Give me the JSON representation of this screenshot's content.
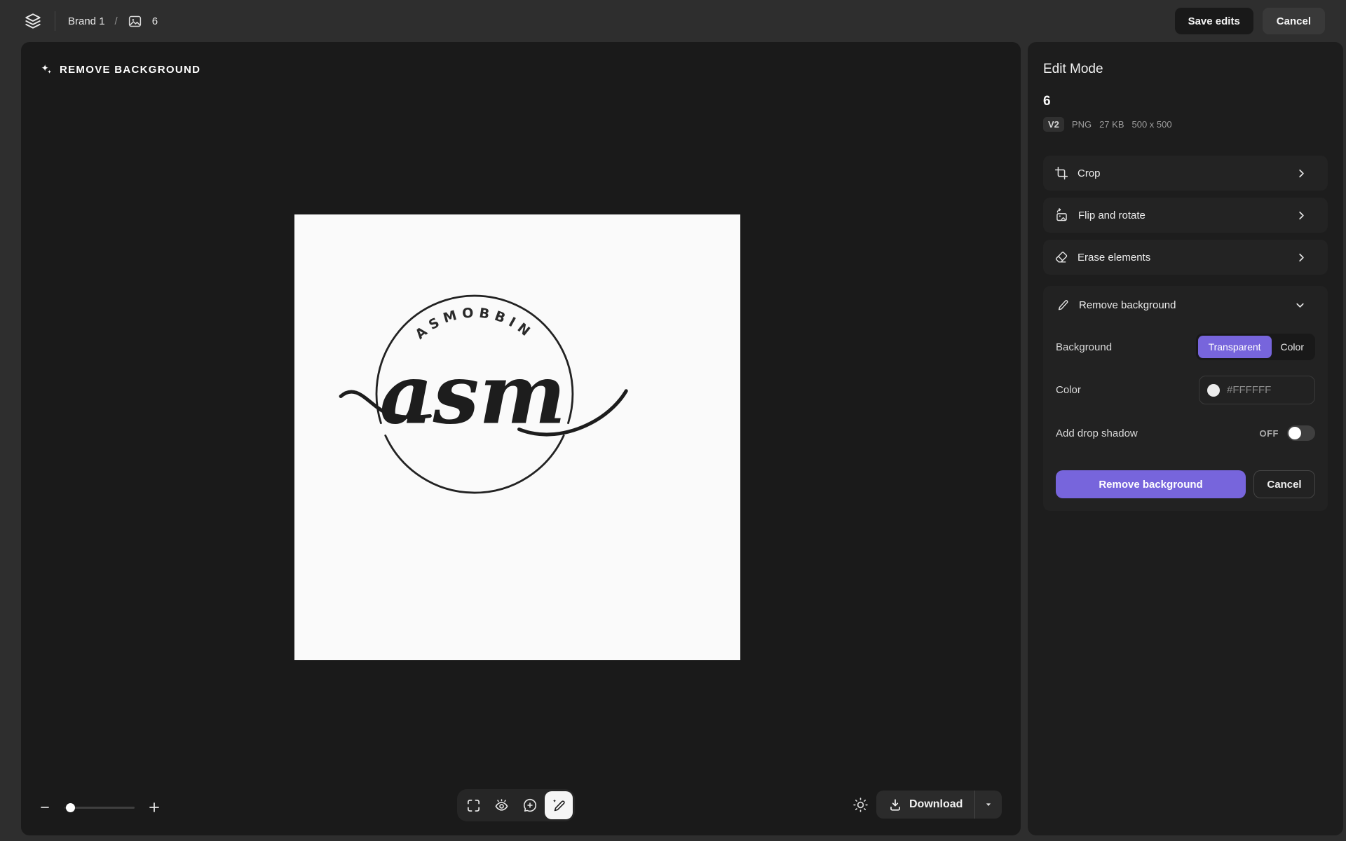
{
  "topbar": {
    "brand": "Brand 1",
    "separator": "/",
    "asset_count": "6",
    "save_label": "Save edits",
    "cancel_label": "Cancel"
  },
  "canvas": {
    "mode_label": "REMOVE BACKGROUND",
    "download_label": "Download",
    "logo": {
      "arc_text": "ASMOBBIN",
      "script_text": "asm"
    }
  },
  "sidebar": {
    "title": "Edit Mode",
    "asset_name": "6",
    "meta": {
      "version": "V2",
      "format": "PNG",
      "file_size": "27 KB",
      "dimensions": "500 x 500"
    },
    "tools": [
      {
        "label": "Crop"
      },
      {
        "label": "Flip and rotate"
      },
      {
        "label": "Erase elements"
      }
    ],
    "remove_bg": {
      "label": "Remove background",
      "background_label": "Background",
      "option_transparent": "Transparent",
      "option_color": "Color",
      "selected_option": "Transparent",
      "color_label": "Color",
      "color_placeholder": "#FFFFFF",
      "shadow_label": "Add drop shadow",
      "shadow_state": "OFF",
      "apply_label": "Remove background",
      "cancel_label": "Cancel"
    }
  },
  "colors": {
    "accent": "#7765dc",
    "topbar_bg": "#2e2e2e",
    "canvas_bg": "#1a1a1a",
    "sidebar_bg": "#1d1d1d",
    "image_bg": "#fafafa"
  }
}
